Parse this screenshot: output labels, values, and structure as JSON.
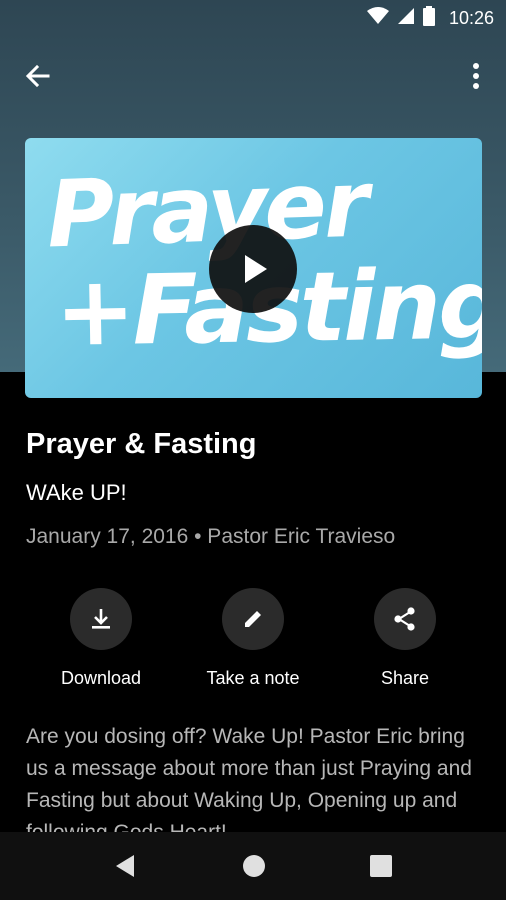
{
  "status_bar": {
    "time": "10:26",
    "icons": [
      "wifi-icon",
      "cell-signal-icon",
      "battery-icon"
    ]
  },
  "app_bar": {
    "back_icon": "arrow-left-icon",
    "menu_icon": "more-vert-icon"
  },
  "artwork": {
    "title_line1": "Prayer",
    "title_line2": "+Fasting",
    "play_icon": "play-icon"
  },
  "sermon": {
    "title": "Prayer & Fasting",
    "subtitle": "WAke UP!",
    "meta": "January 17, 2016 • Pastor Eric Travieso",
    "description": "Are you dosing off? Wake Up! Pastor Eric bring us a message about more than just Praying and Fasting but about Waking Up, Opening up and following Gods Heart!"
  },
  "actions": [
    {
      "label": "Download",
      "icon": "download-icon"
    },
    {
      "label": "Take a note",
      "icon": "pencil-icon"
    },
    {
      "label": "Share",
      "icon": "share-icon"
    }
  ],
  "nav_bar": {
    "icons": [
      "back-triangle-icon",
      "home-circle-icon",
      "recents-square-icon"
    ]
  },
  "colors": {
    "header_gradient_top": "#2e4653",
    "artwork_blue": "#6cc6e4",
    "background": "#000000",
    "secondary_text": "#a9a9a9",
    "action_circle": "#2b2b2b"
  }
}
